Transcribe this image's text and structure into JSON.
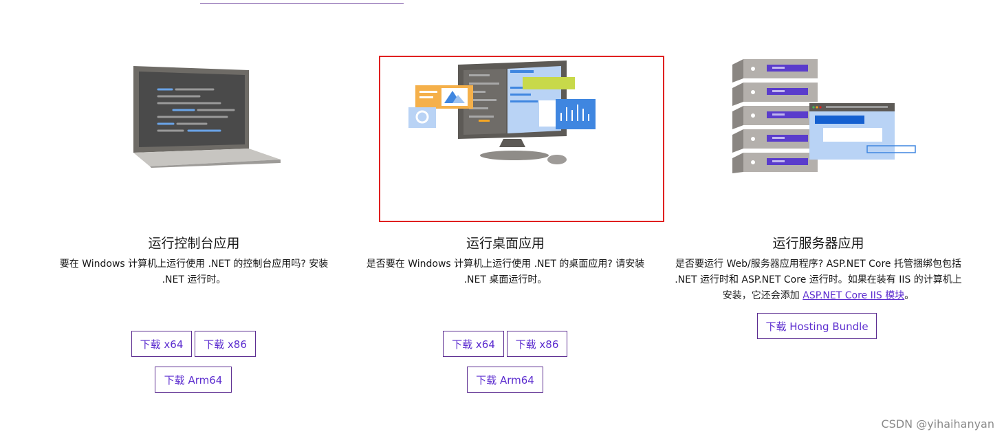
{
  "cards": [
    {
      "title": "运行控制台应用",
      "description_line1": "要在 Windows 计算机上运行使用 .NET 的控制台应用吗? 安装",
      "description_line2": ".NET 运行时。",
      "buttons": [
        "下载 x64",
        "下载 x86",
        "下载 Arm64"
      ]
    },
    {
      "title": "运行桌面应用",
      "description_line1": "是否要在 Windows 计算机上运行使用 .NET 的桌面应用? 请安装",
      "description_line2": ".NET 桌面运行时。",
      "buttons": [
        "下载 x64",
        "下载 x86",
        "下载 Arm64"
      ]
    },
    {
      "title": "运行服务器应用",
      "description_line1": "是否要运行 Web/服务器应用程序? ASP.NET Core 托管捆绑包包括",
      "description_line2": ".NET 运行时和 ASP.NET Core 运行时。如果在装有 IIS 的计算机上",
      "description_line3_prefix": "安装，它还会添加 ",
      "description_link": "ASP.NET Core IIS 模块",
      "description_line3_suffix": "。",
      "buttons": [
        "下载 Hosting Bundle"
      ]
    }
  ],
  "watermark": "CSDN @yihaihanyan",
  "colors": {
    "accent": "#5c2dcf",
    "highlight_border": "#e02020"
  },
  "icons": [
    "laptop-illustration",
    "desktop-monitor-illustration",
    "server-rack-illustration"
  ]
}
